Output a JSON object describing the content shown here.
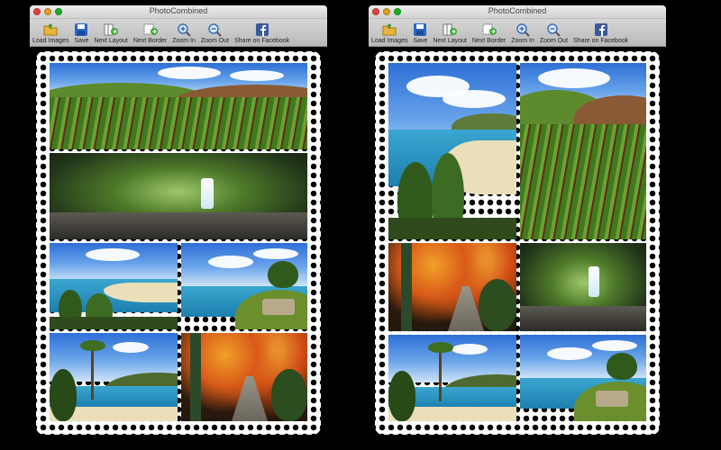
{
  "windows": [
    {
      "title": "PhotoCombined",
      "toolbar": [
        {
          "label": "Load Images",
          "icon": "folder-icon"
        },
        {
          "label": "Save",
          "icon": "save-icon"
        },
        {
          "label": "Next Layout",
          "icon": "next-layout-icon"
        },
        {
          "label": "Next Border",
          "icon": "next-border-icon"
        },
        {
          "label": "Zoom In",
          "icon": "zoom-in-icon"
        },
        {
          "label": "Zoom Out",
          "icon": "zoom-out-icon"
        },
        {
          "label": "Share on Facebook",
          "icon": "facebook-icon"
        }
      ]
    },
    {
      "title": "PhotoCombined",
      "toolbar": [
        {
          "label": "Load Images",
          "icon": "folder-icon"
        },
        {
          "label": "Save",
          "icon": "save-icon"
        },
        {
          "label": "Next Layout",
          "icon": "next-layout-icon"
        },
        {
          "label": "Next Border",
          "icon": "next-border-icon"
        },
        {
          "label": "Zoom In",
          "icon": "zoom-in-icon"
        },
        {
          "label": "Zoom Out",
          "icon": "zoom-out-icon"
        },
        {
          "label": "Share on Facebook",
          "icon": "facebook-icon"
        }
      ]
    }
  ],
  "colors": {
    "background": "#000000",
    "border": "#ffffff",
    "toolbar": "#c8c8c8"
  }
}
